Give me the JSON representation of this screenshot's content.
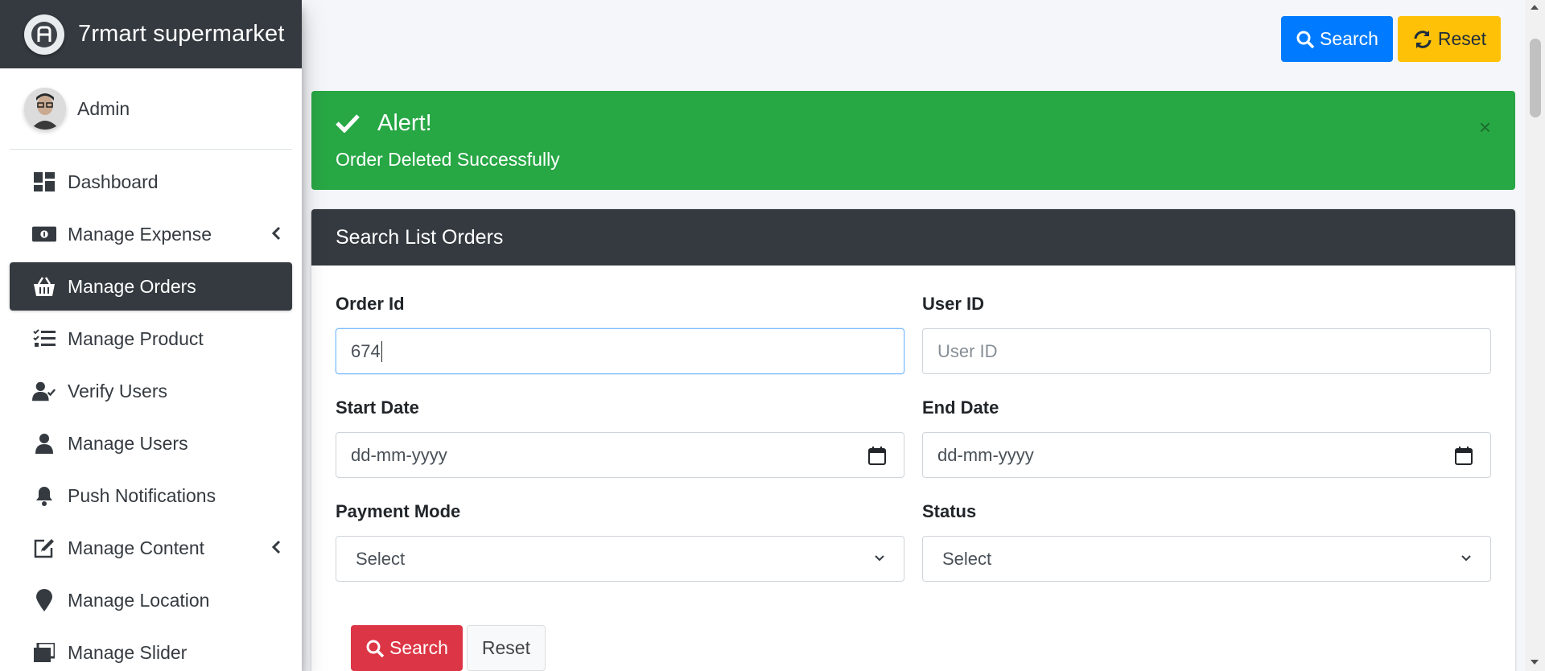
{
  "brand": {
    "name": "7rmart supermarket"
  },
  "user": {
    "name": "Admin"
  },
  "sidebar": {
    "items": [
      {
        "label": "Dashboard",
        "icon": "dashboard-icon"
      },
      {
        "label": "Manage Expense",
        "icon": "money-bill-icon",
        "has_submenu": true
      },
      {
        "label": "Manage Orders",
        "icon": "basket-icon",
        "active": true
      },
      {
        "label": "Manage Product",
        "icon": "tasks-icon"
      },
      {
        "label": "Verify Users",
        "icon": "user-check-icon"
      },
      {
        "label": "Manage Users",
        "icon": "user-icon"
      },
      {
        "label": "Push Notifications",
        "icon": "bell-icon"
      },
      {
        "label": "Manage Content",
        "icon": "edit-icon",
        "has_submenu": true
      },
      {
        "label": "Manage Location",
        "icon": "map-marker-icon"
      },
      {
        "label": "Manage Slider",
        "icon": "slider-icon"
      }
    ]
  },
  "top_actions": {
    "search_label": "Search",
    "reset_label": "Reset"
  },
  "alert": {
    "title": "Alert!",
    "message": "Order Deleted Successfully",
    "close": "×"
  },
  "search_card": {
    "title": "Search List Orders",
    "order_id": {
      "label": "Order Id",
      "value": "674"
    },
    "user_id": {
      "label": "User ID",
      "placeholder": "User ID"
    },
    "start_date": {
      "label": "Start Date",
      "placeholder": "dd-mm-yyyy"
    },
    "end_date": {
      "label": "End Date",
      "placeholder": "dd-mm-yyyy"
    },
    "payment_mode": {
      "label": "Payment Mode",
      "selected": "Select"
    },
    "status": {
      "label": "Status",
      "selected": "Select"
    },
    "search_label": "Search",
    "reset_label": "Reset"
  },
  "colors": {
    "sidebar_dark": "#343a40",
    "primary": "#007bff",
    "warning": "#ffc107",
    "success": "#28a745",
    "danger": "#dc3545"
  }
}
